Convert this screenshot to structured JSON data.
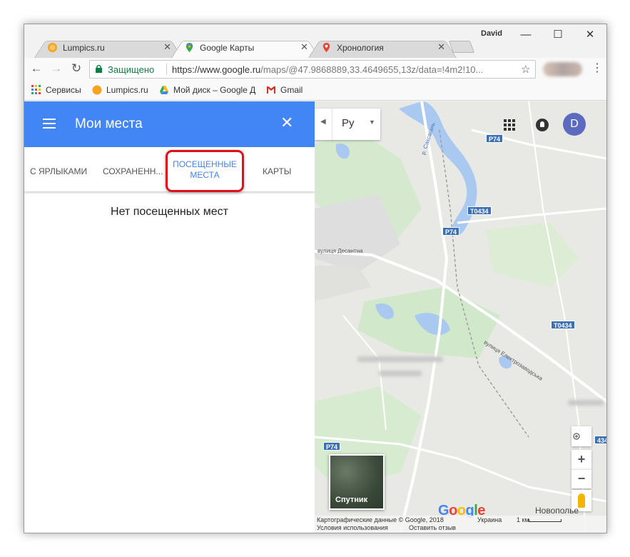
{
  "window": {
    "user_name": "David",
    "controls": {
      "minimize": "—",
      "maximize": "☐",
      "close": "✕"
    }
  },
  "tabs": [
    {
      "title": "Lumpics.ru",
      "close": "✕",
      "active": false
    },
    {
      "title": "Google Карты",
      "close": "✕",
      "active": true
    },
    {
      "title": "Хронология",
      "close": "✕",
      "active": false
    }
  ],
  "toolbar": {
    "back": "←",
    "forward": "→",
    "reload": "↻",
    "secure_label": "Защищено",
    "url_host": "https://www.google.ru",
    "url_path": "/maps/@47.9868889,33.4649655,13z/data=!4m2!10...",
    "star": "☆",
    "menu": "⋮"
  },
  "bookmarks": [
    {
      "label": "Сервисы"
    },
    {
      "label": "Lumpics.ru"
    },
    {
      "label": "Мой диск – Google Д"
    },
    {
      "label": "Gmail"
    }
  ],
  "panel": {
    "title": "Мои места",
    "close": "✕",
    "tabs": [
      {
        "label": "С ЯРЛЫКАМИ"
      },
      {
        "label": "СОХРАНЕНН..."
      },
      {
        "label_line1": "ПОСЕЩЕННЫЕ",
        "label_line2": "МЕСТА",
        "active": true
      },
      {
        "label": "КАРТЫ"
      }
    ],
    "empty_message": "Нет посещенных мест"
  },
  "map": {
    "language_value": "Ру",
    "avatar_letter": "D",
    "road_labels": [
      "P74",
      "T0434",
      "P74",
      "T0434",
      "P74",
      "434"
    ],
    "street_labels": [
      "вулиця Десантна",
      "вулиця Електрозаводська",
      "р. Саксагань"
    ],
    "satellite_label": "Спутник",
    "zoom_in": "+",
    "zoom_out": "−",
    "google_letters": [
      "G",
      "o",
      "o",
      "g",
      "l",
      "e"
    ],
    "place_name": "Новополье",
    "footer": {
      "data_credit": "Картографические данные © Google, 2018",
      "country": "Украина",
      "scale": "1 км",
      "terms": "Условия использования",
      "feedback": "Оставить отзыв"
    },
    "colors": {
      "water": "#a9c9f1",
      "park": "#cfe8c8",
      "road": "#ffffff",
      "header": "#4285f4",
      "highlight": "#e0101b"
    }
  }
}
